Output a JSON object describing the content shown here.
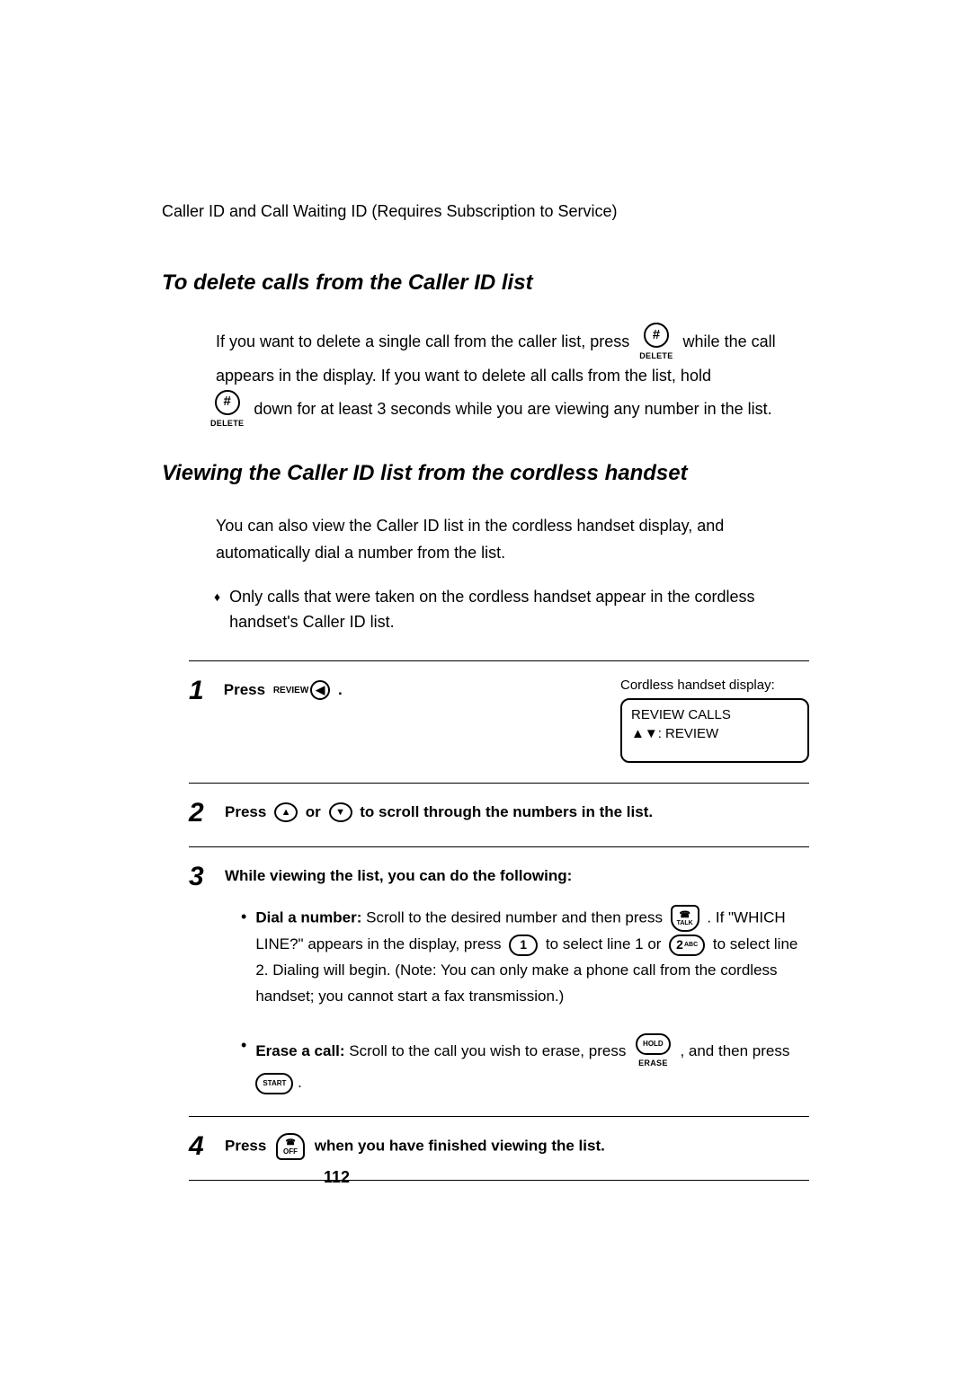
{
  "header": "Caller ID and Call Waiting ID (Requires Subscription to Service)",
  "section1": {
    "title": "To delete calls from the Caller ID list",
    "text1a": "If you want to delete a single call from the caller list, press ",
    "text1b": " while the call appears in the display. If you want to delete all calls from the list, hold ",
    "text1c": " down for at least 3 seconds while you are viewing any number in the list.",
    "hash": "#",
    "delete": "DELETE"
  },
  "section2": {
    "title": "Viewing the Caller ID list from the cordless handset",
    "intro": "You can also view the Caller ID list in the cordless handset display, and automatically dial a number from the list.",
    "bullet1": "Only calls that were taken on the cordless handset appear in the cordless handset's Caller ID list."
  },
  "steps": {
    "s1": {
      "num": "1",
      "press": "Press ",
      "review": "REVIEW",
      "arrow": "◀",
      "dot": ".",
      "caption": "Cordless handset display:",
      "line1": "REVIEW CALLS",
      "line2": "▲▼: REVIEW"
    },
    "s2": {
      "num": "2",
      "a": "Press ",
      "up": "▲",
      "or": " or ",
      "down": "▼",
      "b": " to scroll through the numbers in the list."
    },
    "s3": {
      "num": "3",
      "lead": "While viewing the list, you can do the following:",
      "dial_lbl": "Dial a number:",
      "dial_a": " Scroll to the desired number and then press ",
      "talk_top": "☎",
      "talk": "TALK",
      "dial_b": ". If \"WHICH LINE?\" appears in the display, press ",
      "one": "1",
      "dial_c": " to select line 1 or ",
      "two": "2",
      "abc": "ABC",
      "dial_d": " to select line 2. Dialing will begin. (Note: You can only make a phone call from the cordless handset; you cannot start a fax transmission.)",
      "erase_lbl": "Erase a call:",
      "erase_a": " Scroll to the call you wish to erase, press ",
      "hold": "HOLD",
      "erase": "ERASE",
      "erase_b": ", and then press ",
      "start": "START",
      "erase_c": "."
    },
    "s4": {
      "num": "4",
      "a": "Press ",
      "off_top": "☎",
      "off": "OFF",
      "b": " when you have finished viewing the list."
    }
  },
  "page_number": "112"
}
